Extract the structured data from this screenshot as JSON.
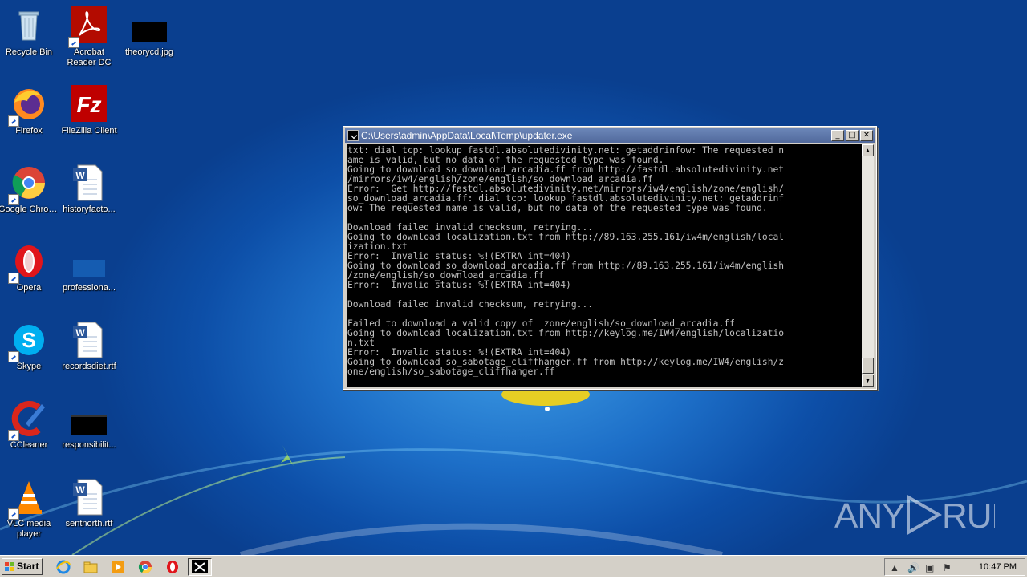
{
  "desktop": {
    "icons": [
      {
        "label": "Recycle Bin"
      },
      {
        "label": "Acrobat Reader DC"
      },
      {
        "label": "theorycd.jpg"
      },
      {
        "label": "Firefox"
      },
      {
        "label": "FileZilla Client"
      },
      {
        "label": "Google Chrome"
      },
      {
        "label": "historyfacto..."
      },
      {
        "label": "Opera"
      },
      {
        "label": "professiona..."
      },
      {
        "label": "Skype"
      },
      {
        "label": "recordsdiet.rtf"
      },
      {
        "label": "CCleaner"
      },
      {
        "label": "responsibilit..."
      },
      {
        "label": "VLC media player"
      },
      {
        "label": "sentnorth.rtf"
      }
    ]
  },
  "console": {
    "title": "C:\\Users\\admin\\AppData\\Local\\Temp\\updater.exe",
    "buttons": {
      "minimize": "_",
      "maximize": "□",
      "close": "✕"
    },
    "output": "txt: dial tcp: lookup fastdl.absolutedivinity.net: getaddrinfow: The requested n\name is valid, but no data of the requested type was found.\nGoing to download so_download_arcadia.ff from http://fastdl.absolutedivinity.net\n/mirrors/iw4/english/zone/english/so_download_arcadia.ff\nError:  Get http://fastdl.absolutedivinity.net/mirrors/iw4/english/zone/english/\nso_download_arcadia.ff: dial tcp: lookup fastdl.absolutedivinity.net: getaddrinf\now: The requested name is valid, but no data of the requested type was found.\n\nDownload failed invalid checksum, retrying...\nGoing to download localization.txt from http://89.163.255.161/iw4m/english/local\nization.txt\nError:  Invalid status: %!(EXTRA int=404)\nGoing to download so_download_arcadia.ff from http://89.163.255.161/iw4m/english\n/zone/english/so_download_arcadia.ff\nError:  Invalid status: %!(EXTRA int=404)\n\nDownload failed invalid checksum, retrying...\n\nFailed to download a valid copy of  zone/english/so_download_arcadia.ff\nGoing to download localization.txt from http://keylog.me/IW4/english/localizatio\nn.txt\nError:  Invalid status: %!(EXTRA int=404)\nGoing to download so_sabotage_cliffhanger.ff from http://keylog.me/IW4/english/z\none/english/so_sabotage_cliffhanger.ff"
  },
  "watermark": {
    "text": "ANY RUN"
  },
  "taskbar": {
    "start_label": "Start",
    "clock": "10:47 PM"
  }
}
